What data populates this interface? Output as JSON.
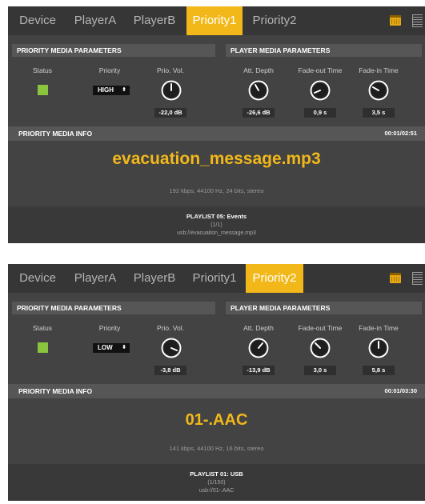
{
  "colors": {
    "accent": "#f2b81a",
    "status_on": "#8bc53f",
    "panel_bg": "#434343",
    "section_header_bg": "#565656"
  },
  "icons": [
    "calendar-icon",
    "list-icon",
    "knob-icon"
  ],
  "panels": [
    {
      "tabs": [
        "Device",
        "PlayerA",
        "PlayerB",
        "Priority1",
        "Priority2"
      ],
      "active_tab": "Priority1",
      "priority_params": {
        "header": "PRIORITY MEDIA PARAMETERS",
        "status_label": "Status",
        "status_on": true,
        "priority_label": "Priority",
        "priority_value": "HIGH",
        "prio_vol_label": "Prio. Vol.",
        "prio_vol_value": "-22,0 dB"
      },
      "player_params": {
        "header": "PLAYER MEDIA PARAMETERS",
        "att_depth_label": "Att. Depth",
        "att_depth_value": "-26,6 dB",
        "fade_out_label": "Fade-out Time",
        "fade_out_value": "0,9 s",
        "fade_in_label": "Fade-in Time",
        "fade_in_value": "3,5 s"
      },
      "info": {
        "header": "PRIORITY MEDIA INFO",
        "time": "00:01/02:51",
        "filename": "evacuation_message.mp3",
        "fileinfo": "192 kbps, 44100 Hz, 24 bits, stereo",
        "playlist": "PLAYLIST 05: Events",
        "count": "(1/1)",
        "path": "usb://evacuation_message.mp3"
      }
    },
    {
      "tabs": [
        "Device",
        "PlayerA",
        "PlayerB",
        "Priority1",
        "Priority2"
      ],
      "active_tab": "Priority2",
      "priority_params": {
        "header": "PRIORITY MEDIA PARAMETERS",
        "status_label": "Status",
        "status_on": true,
        "priority_label": "Priority",
        "priority_value": "LOW",
        "prio_vol_label": "Prio. Vol.",
        "prio_vol_value": "-3,8 dB"
      },
      "player_params": {
        "header": "PLAYER MEDIA PARAMETERS",
        "att_depth_label": "Att. Depth",
        "att_depth_value": "-13,9 dB",
        "fade_out_label": "Fade-out Time",
        "fade_out_value": "3,0 s",
        "fade_in_label": "Fade-in Time",
        "fade_in_value": "5,8 s"
      },
      "info": {
        "header": "PRIORITY MEDIA INFO",
        "time": "00:01/03:30",
        "filename": "01-.AAC",
        "fileinfo": "141 kbps, 44100 Hz, 16 bits, stereo",
        "playlist": "PLAYLIST 01: USB",
        "count": "(1/150)",
        "path": "usb://01-.AAC"
      }
    }
  ]
}
